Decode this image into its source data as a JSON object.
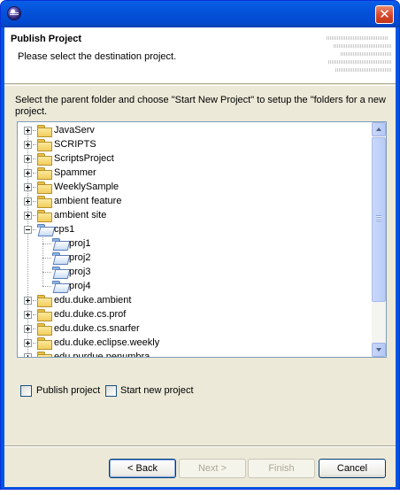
{
  "window": {
    "close_glyph": "✕",
    "icon": "eclipse-icon"
  },
  "banner": {
    "title": "Publish Project",
    "message": "Please select the destination project."
  },
  "instructions": "Select the parent folder and choose \"Start New Project\" to setup the \"folders for a new project.",
  "tree": {
    "items": [
      {
        "label": "JavaServ",
        "expanded": false,
        "depth": 0
      },
      {
        "label": "SCRIPTS",
        "expanded": false,
        "depth": 0
      },
      {
        "label": "ScriptsProject",
        "expanded": false,
        "depth": 0
      },
      {
        "label": "Spammer",
        "expanded": false,
        "depth": 0
      },
      {
        "label": "WeeklySample",
        "expanded": false,
        "depth": 0
      },
      {
        "label": "ambient feature",
        "expanded": false,
        "depth": 0
      },
      {
        "label": "ambient site",
        "expanded": false,
        "depth": 0
      },
      {
        "label": "cps1",
        "expanded": true,
        "depth": 0
      },
      {
        "label": "proj1",
        "expanded": null,
        "depth": 1
      },
      {
        "label": "proj2",
        "expanded": null,
        "depth": 1
      },
      {
        "label": "proj3",
        "expanded": null,
        "depth": 1
      },
      {
        "label": "proj4",
        "expanded": null,
        "depth": 1
      },
      {
        "label": "edu.duke.ambient",
        "expanded": false,
        "depth": 0
      },
      {
        "label": "edu.duke.cs.prof",
        "expanded": false,
        "depth": 0
      },
      {
        "label": "edu.duke.cs.snarfer",
        "expanded": false,
        "depth": 0
      },
      {
        "label": "edu.duke.eclipse.weekly",
        "expanded": false,
        "depth": 0
      },
      {
        "label": "edu.purdue.penumbra",
        "expanded": false,
        "depth": 0
      }
    ]
  },
  "options": {
    "publish_label": "Publish project",
    "publish_checked": false,
    "start_new_label": "Start new project",
    "start_new_checked": false
  },
  "buttons": {
    "back": "< Back",
    "next": "Next >",
    "finish": "Finish",
    "cancel": "Cancel"
  }
}
